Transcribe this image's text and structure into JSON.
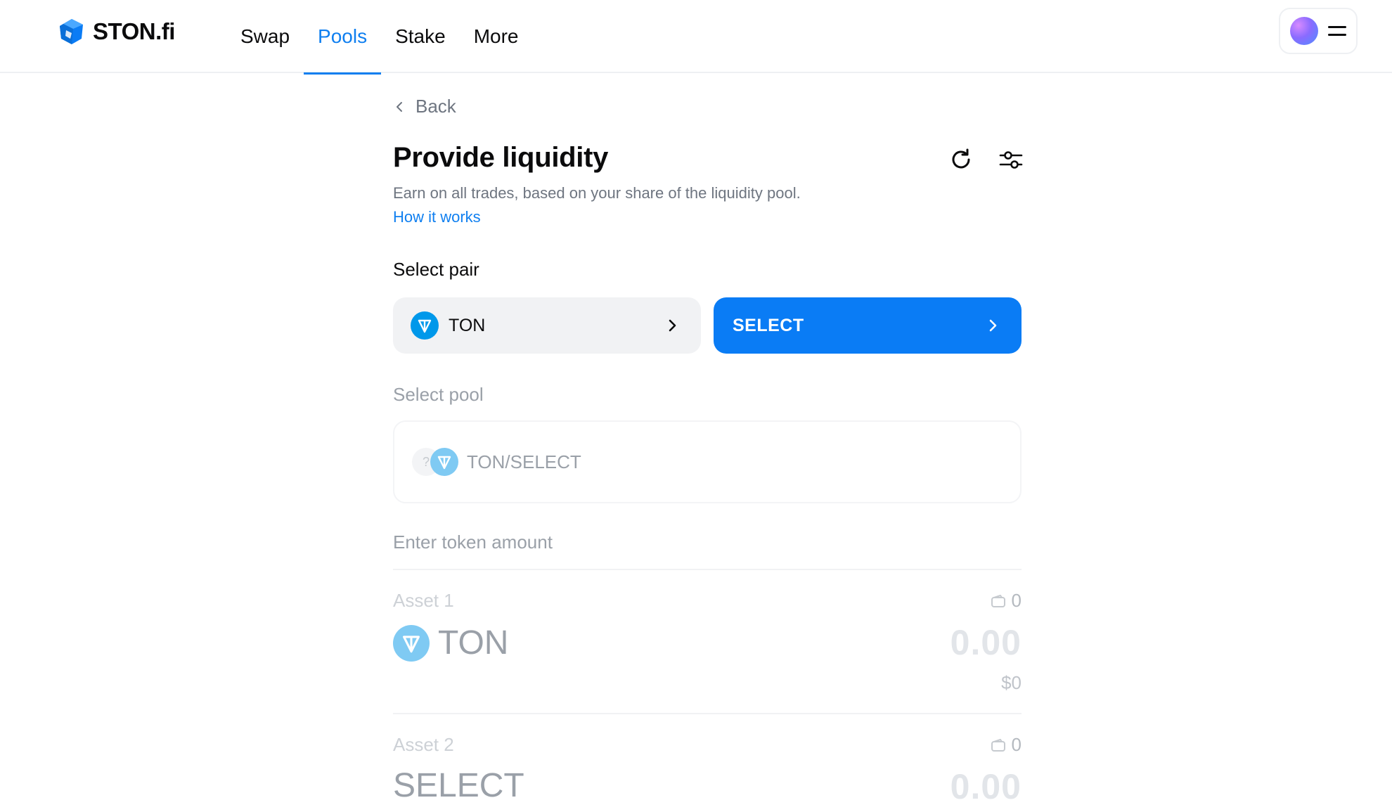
{
  "header": {
    "logo_text": "STON.fi",
    "nav": [
      {
        "label": "Swap",
        "active": false
      },
      {
        "label": "Pools",
        "active": true
      },
      {
        "label": "Stake",
        "active": false
      },
      {
        "label": "More",
        "active": false
      }
    ]
  },
  "main": {
    "back_label": "Back",
    "title": "Provide liquidity",
    "subtitle": "Earn on all trades, based on your share of the liquidity pool.",
    "how_link": "How it works",
    "select_pair_label": "Select pair",
    "pair": {
      "left_token": "TON",
      "right_label": "SELECT"
    },
    "select_pool_label": "Select pool",
    "pool_name": "TON/SELECT",
    "pool_unknown_glyph": "?",
    "enter_amount_label": "Enter token amount",
    "asset1": {
      "label": "Asset 1",
      "balance": "0",
      "token": "TON",
      "amount": "0.00",
      "usd": "$0"
    },
    "asset2": {
      "label": "Asset 2",
      "balance": "0",
      "token": "SELECT",
      "amount": "0.00"
    }
  },
  "colors": {
    "accent": "#0f7ff0",
    "button_blue": "#0a7cf5",
    "ton_blue": "#0098ea",
    "muted_text": "#6e7580"
  }
}
